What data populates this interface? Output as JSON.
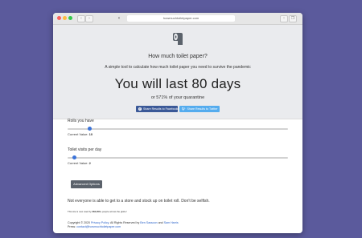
{
  "browser": {
    "url": "howmuchtoiletpaper.com",
    "nav_back": "‹",
    "nav_forward": "›"
  },
  "hero": {
    "title": "How much toilet paper?",
    "subtitle": "A simple tool to calculate how much toilet paper you need to survive the pandemic",
    "result_prefix": "You will last",
    "result_days": "80",
    "result_suffix": "days",
    "pct_prefix": "or",
    "pct_value": "571%",
    "pct_suffix": "of your quarantine",
    "share_facebook": "Share Results to Facebook",
    "share_twitter": "Share Results to Twitter"
  },
  "controls": {
    "rolls": {
      "label": "Rolls you have",
      "current_label": "Current Value:",
      "value": "10",
      "fraction": 0.1
    },
    "visits": {
      "label": "Toilet visits per day",
      "current_label": "Current Value:",
      "value": "2",
      "fraction": 0.03
    },
    "advanced_button": "Advanced Options"
  },
  "notes": {
    "warning": "Not everyone is able to get to a store and stock up on toilet roll. Don't be selfish.",
    "usage_prefix": "This site is now used by",
    "usage_count": "384,000+",
    "usage_suffix": "people across the globe!"
  },
  "footer": {
    "copyright": "Copyright © 2020",
    "privacy_link": "Privacy Policy",
    "rights": ". All Rights Reserved by",
    "author1": "Ben Sassoon",
    "and": "and",
    "author2": "Sam Harris",
    "press_label": "Press:",
    "press_email": "contact@howmuchtoiletpaper.com"
  },
  "colors": {
    "background": "#5b5a9c",
    "facebook": "#3b5998",
    "twitter": "#55acee",
    "slider_thumb": "#3b73d9",
    "advanced_button": "#5b626b"
  }
}
